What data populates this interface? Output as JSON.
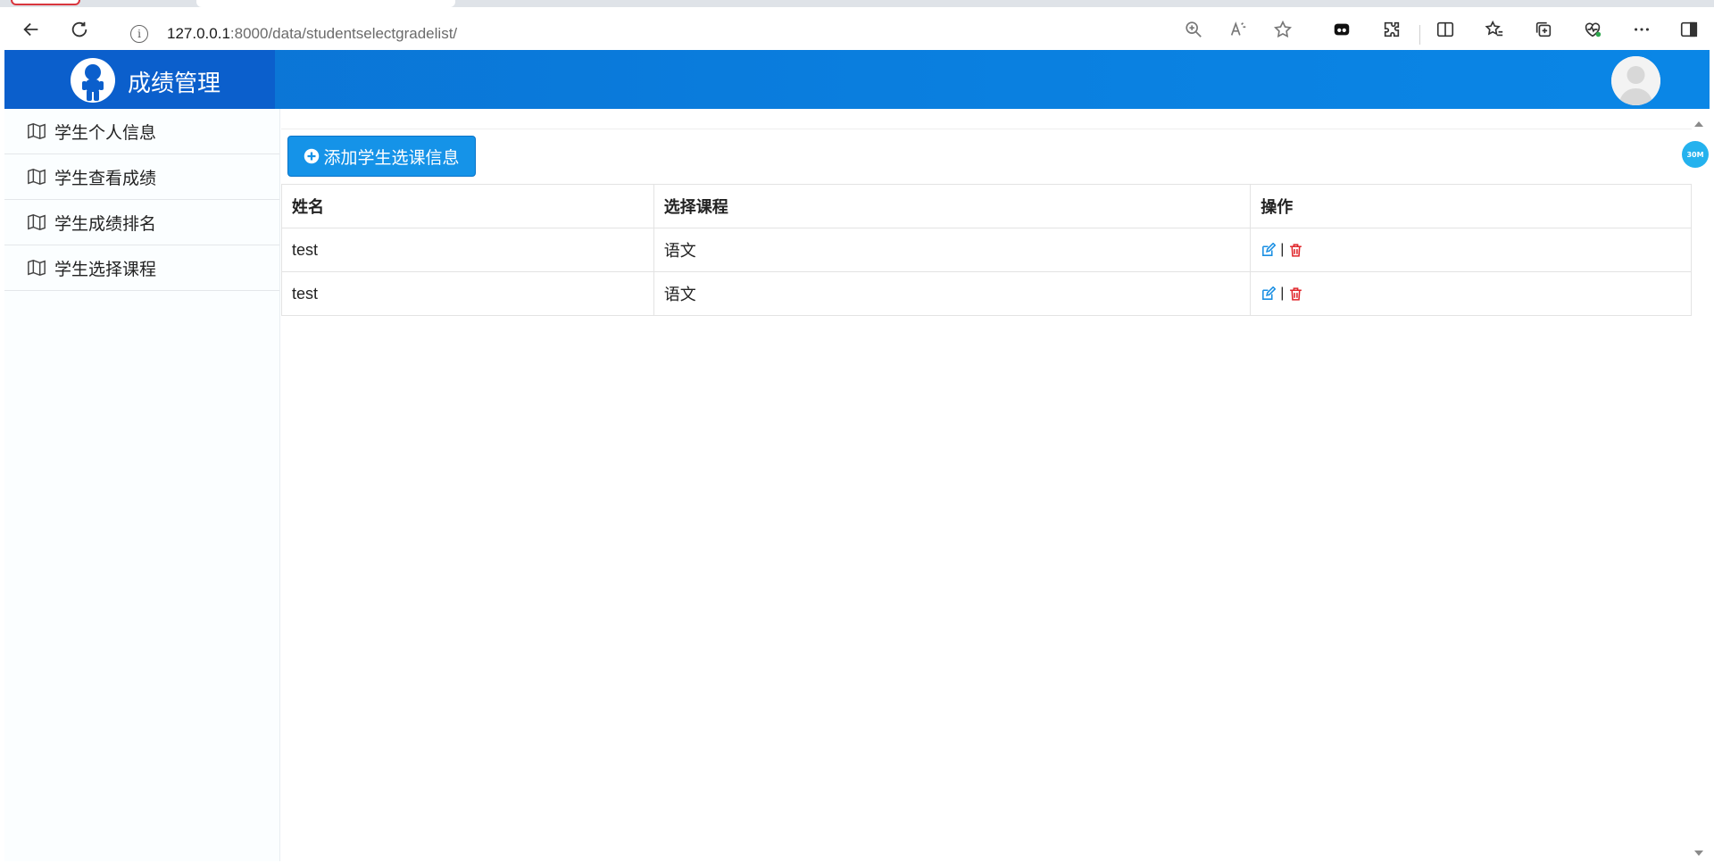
{
  "browser": {
    "url_host": "127.0.0.1",
    "url_path": ":8000/data/studentselectgradelist/"
  },
  "app": {
    "title": "成绩管理"
  },
  "sidebar": {
    "items": [
      {
        "label": "学生个人信息"
      },
      {
        "label": "学生查看成绩"
      },
      {
        "label": "学生成绩排名"
      },
      {
        "label": "学生选择课程"
      }
    ]
  },
  "main": {
    "add_button_label": "添加学生选课信息",
    "table": {
      "headers": [
        "姓名",
        "选择课程",
        "操作"
      ],
      "rows": [
        {
          "name": "test",
          "course": "语文",
          "sep": "|"
        },
        {
          "name": "test",
          "course": "语文",
          "sep": "|"
        }
      ]
    }
  },
  "badge": {
    "text": "30M"
  },
  "colors": {
    "header_blue": "#0a80e0",
    "brand_blue": "#0b5fcc",
    "button_blue": "#1593e8",
    "edit_icon": "#1a8fe3",
    "delete_icon": "#e0262b"
  },
  "icons": {
    "back": "back-arrow-icon",
    "reload": "reload-icon",
    "info": "info-icon",
    "zoom": "zoom-in-icon",
    "read_aloud": "read-aloud-icon",
    "favorite": "star-icon",
    "sidebar_map": "map-icon",
    "add": "plus-circle-icon",
    "edit": "edit-icon",
    "delete": "trash-icon"
  }
}
